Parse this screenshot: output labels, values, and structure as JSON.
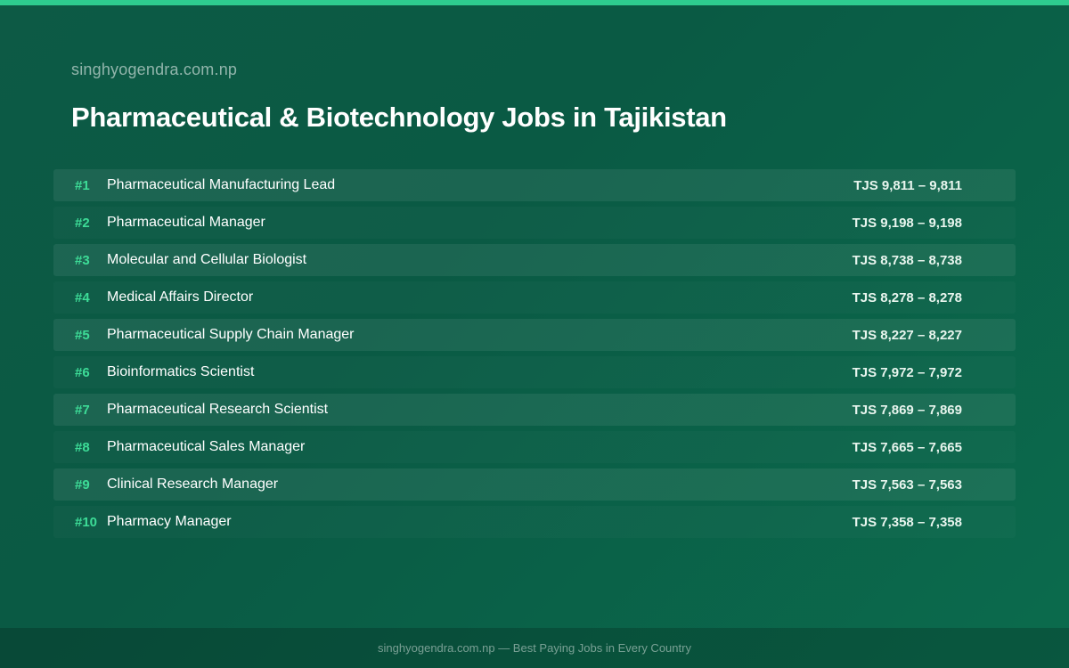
{
  "header": {
    "site": "singhyogendra.com.np",
    "title": "Pharmaceutical & Biotechnology Jobs in Tajikistan"
  },
  "jobs": [
    {
      "rank": "#1",
      "title": "Pharmaceutical Manufacturing Lead",
      "salary": "TJS 9,811 – 9,811"
    },
    {
      "rank": "#2",
      "title": "Pharmaceutical Manager",
      "salary": "TJS 9,198 – 9,198"
    },
    {
      "rank": "#3",
      "title": "Molecular and Cellular Biologist",
      "salary": "TJS 8,738 – 8,738"
    },
    {
      "rank": "#4",
      "title": "Medical Affairs Director",
      "salary": "TJS 8,278 – 8,278"
    },
    {
      "rank": "#5",
      "title": "Pharmaceutical Supply Chain Manager",
      "salary": "TJS 8,227 – 8,227"
    },
    {
      "rank": "#6",
      "title": "Bioinformatics Scientist",
      "salary": "TJS 7,972 – 7,972"
    },
    {
      "rank": "#7",
      "title": "Pharmaceutical Research Scientist",
      "salary": "TJS 7,869 – 7,869"
    },
    {
      "rank": "#8",
      "title": "Pharmaceutical Sales Manager",
      "salary": "TJS 7,665 – 7,665"
    },
    {
      "rank": "#9",
      "title": "Clinical Research Manager",
      "salary": "TJS 7,563 – 7,563"
    },
    {
      "rank": "#10",
      "title": "Pharmacy Manager",
      "salary": "TJS 7,358 – 7,358"
    }
  ],
  "footer": {
    "text": "singhyogendra.com.np — Best Paying Jobs in Every Country"
  },
  "colors": {
    "accent": "#2ecc8f",
    "rank": "#3ddc97",
    "background": "#0a5a44"
  }
}
